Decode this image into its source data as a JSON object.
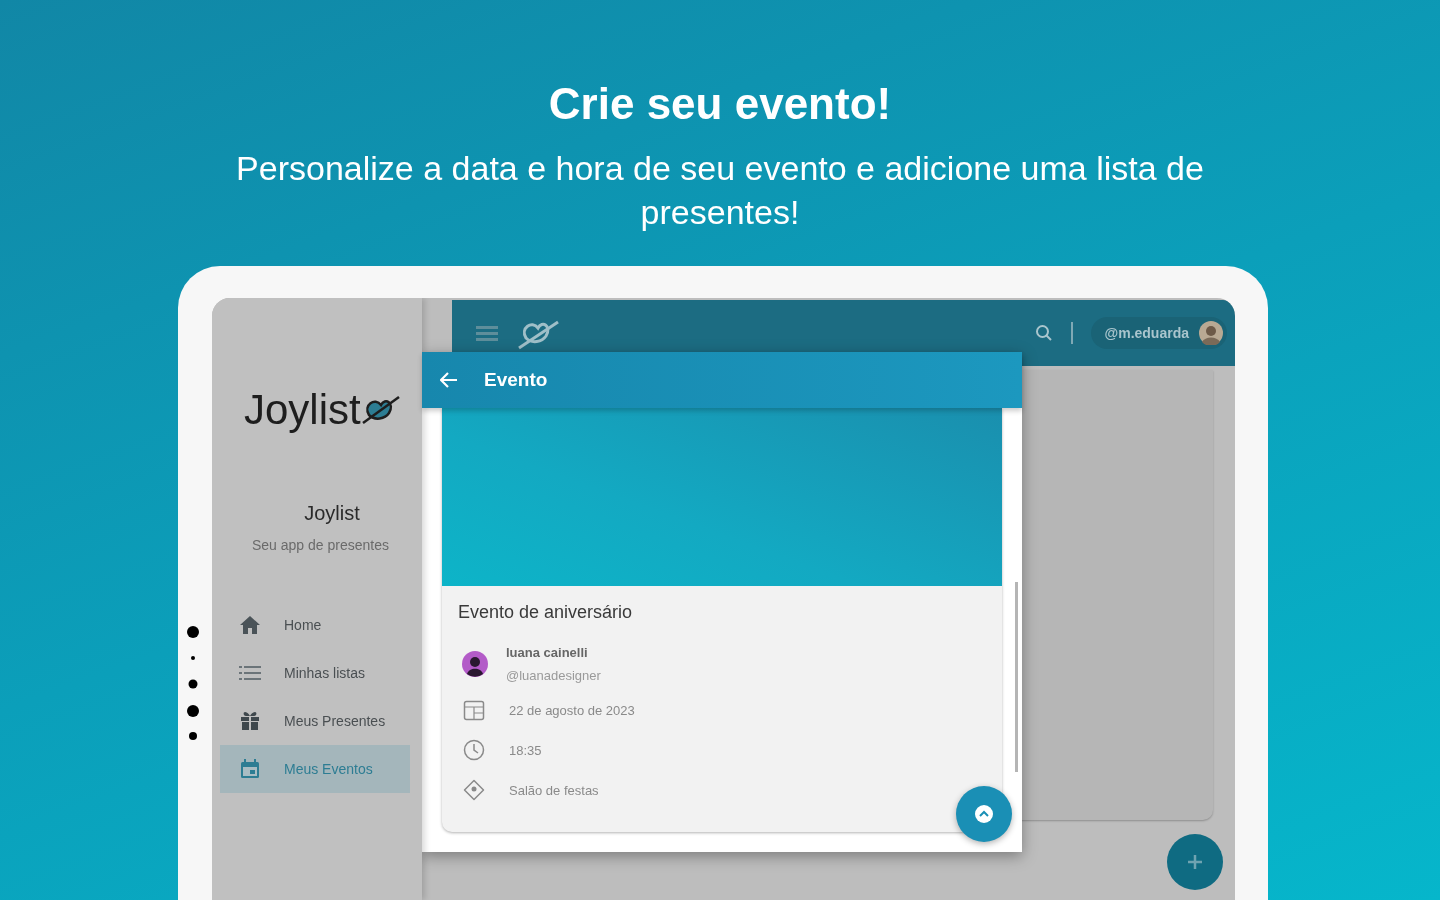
{
  "headline": "Crie seu evento!",
  "subtitle": "Personalize a data e hora de seu evento e adicione uma lista de presentes!",
  "sidebar": {
    "logo_text": "Joylist",
    "app_name": "Joylist",
    "tagline": "Seu app de presentes",
    "items": [
      {
        "label": "Home",
        "kind": "home",
        "selected": false
      },
      {
        "label": "Minhas listas",
        "kind": "list",
        "selected": false
      },
      {
        "label": "Meus Presentes",
        "kind": "gift",
        "selected": false
      },
      {
        "label": "Meus Eventos",
        "kind": "calendar",
        "selected": true
      }
    ]
  },
  "topbar": {
    "username": "@m.eduarda"
  },
  "dialog": {
    "title": "Evento",
    "event_name": "Evento de aniversário",
    "organizer": {
      "name": "luana cainelli",
      "handle": "@luanadesigner"
    },
    "details": [
      {
        "kind": "date",
        "text": "22 de agosto de 2023"
      },
      {
        "kind": "time",
        "text": "18:35"
      },
      {
        "kind": "place",
        "text": "Salão de festas"
      }
    ]
  }
}
